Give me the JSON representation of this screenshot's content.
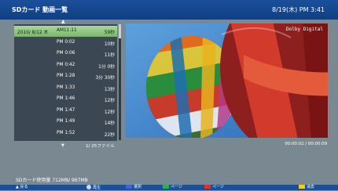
{
  "header": {
    "title": "SDカード 動画一覧",
    "datetime": "8/19(木) PM  3:41"
  },
  "list": {
    "rows": [
      {
        "date": "2010/ 8/12  木",
        "time": "AM11:11",
        "duration": "59秒",
        "selected": true
      },
      {
        "date": "",
        "time": "PM 0:02",
        "duration": "10秒"
      },
      {
        "date": "",
        "time": "PM 0:06",
        "duration": "11秒"
      },
      {
        "date": "",
        "time": "PM 0:42",
        "duration": "1分  0秒"
      },
      {
        "date": "",
        "time": "PM 1:28",
        "duration": "3分 30秒"
      },
      {
        "date": "",
        "time": "PM 1:33",
        "duration": "13秒"
      },
      {
        "date": "",
        "time": "PM 1:46",
        "duration": "12秒"
      },
      {
        "date": "",
        "time": "PM 1:47",
        "duration": "12秒"
      },
      {
        "date": "",
        "time": "PM 1:49",
        "duration": "14秒"
      },
      {
        "date": "",
        "time": "PM 1:52",
        "duration": "22秒"
      }
    ],
    "file_count": "1/  25ファイル"
  },
  "preview": {
    "audio_badge": "Dolby Digital",
    "timecode": "00:00:02 / 00:00:09"
  },
  "status": {
    "usage": "SDカード使用量    712MB/  967MB"
  },
  "footer": {
    "items": [
      {
        "icon": "up-arrow-icon",
        "label": "戻る"
      },
      {
        "icon": "ok-circle-icon",
        "label": "再生"
      },
      {
        "icon": "blue-button",
        "label": "選択"
      },
      {
        "icon": "green-button",
        "label": "ページ"
      },
      {
        "icon": "red-button",
        "label": "ページ"
      },
      {
        "icon": "yellow-button",
        "label": "消去"
      }
    ],
    "colors": {
      "blue": "#3a66d8",
      "green": "#25b14b",
      "red": "#e0302a",
      "yellow": "#f1d117"
    }
  }
}
